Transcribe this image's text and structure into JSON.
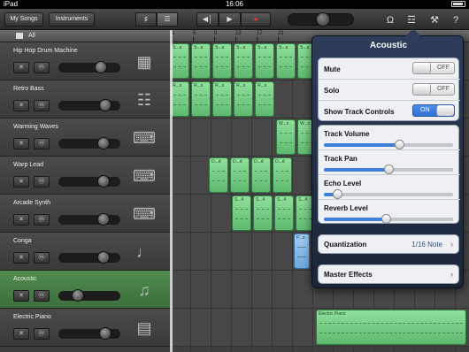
{
  "status": {
    "carrier": "iPad",
    "time": "16:06"
  },
  "toolbar": {
    "my_songs": "My Songs",
    "instruments": "Instruments",
    "icons": [
      "guitar-icon",
      "tracks-view-icon",
      "rewind-icon",
      "play-icon",
      "record-icon",
      "metronome-icon",
      "mixer-icon",
      "wrench-icon",
      "help-icon"
    ]
  },
  "allbar": {
    "label": "All"
  },
  "ruler": {
    "ticks": [
      "1",
      "5",
      "9",
      "13",
      "17",
      "21"
    ]
  },
  "tracks": [
    {
      "name": "Hip Hop Drum Machine",
      "icon": "drum-machine-icon",
      "volume": 0.7
    },
    {
      "name": "Retro Bass",
      "icon": "synth-icon",
      "volume": 0.8
    },
    {
      "name": "Warming Waves",
      "icon": "keyboard-icon",
      "volume": 0.75
    },
    {
      "name": "Warp Lead",
      "icon": "keyboard-icon",
      "volume": 0.75
    },
    {
      "name": "Arcade Synth",
      "icon": "keyboard-icon",
      "volume": 0.75
    },
    {
      "name": "Conga",
      "icon": "conga-icon",
      "volume": 0.75
    },
    {
      "name": "Acoustic",
      "icon": "guitar-icon",
      "volume": 0.25,
      "selected": true
    },
    {
      "name": "Electric Piano",
      "icon": "amp-icon",
      "volume": 0.8
    }
  ],
  "regions": [
    {
      "lane": 0,
      "labels": [
        "S...a",
        "S...a",
        "S...a",
        "S...a",
        "S...a",
        "S...a",
        "S...a"
      ],
      "color": "green"
    },
    {
      "lane": 1,
      "labels": [
        "R...s",
        "R...s",
        "R...s",
        "R...s",
        "R...s"
      ],
      "color": "green"
    },
    {
      "lane": 2,
      "labels": [
        "W...s",
        "W...s",
        "W...s",
        "W...s",
        "W...s",
        "W...s",
        "W...s"
      ],
      "color": "green"
    },
    {
      "lane": 3,
      "labels": [
        "D...d",
        "D...d",
        "D...d",
        "D...d"
      ],
      "color": "green"
    },
    {
      "lane": 4,
      "labels": [
        "S...4",
        "S...4",
        "S...4",
        "S...4",
        "S...4"
      ],
      "color": "green"
    },
    {
      "lane": 5,
      "labels": [
        "P...s"
      ],
      "color": "blue"
    },
    {
      "lane": 7,
      "labels": [
        "Electric Piano"
      ],
      "color": "green"
    }
  ],
  "popover": {
    "title": "Acoustic",
    "mute": {
      "label": "Mute",
      "state": "OFF"
    },
    "solo": {
      "label": "Solo",
      "state": "OFF"
    },
    "show_controls": {
      "label": "Show Track Controls",
      "state": "ON"
    },
    "sliders": [
      {
        "label": "Track Volume",
        "value": 0.58
      },
      {
        "label": "Track Pan",
        "value": 0.5
      },
      {
        "label": "Echo Level",
        "value": 0.1
      },
      {
        "label": "Reverb Level",
        "value": 0.48
      }
    ],
    "quantization": {
      "label": "Quantization",
      "value": "1/16 Note"
    },
    "master_effects": {
      "label": "Master Effects"
    }
  }
}
